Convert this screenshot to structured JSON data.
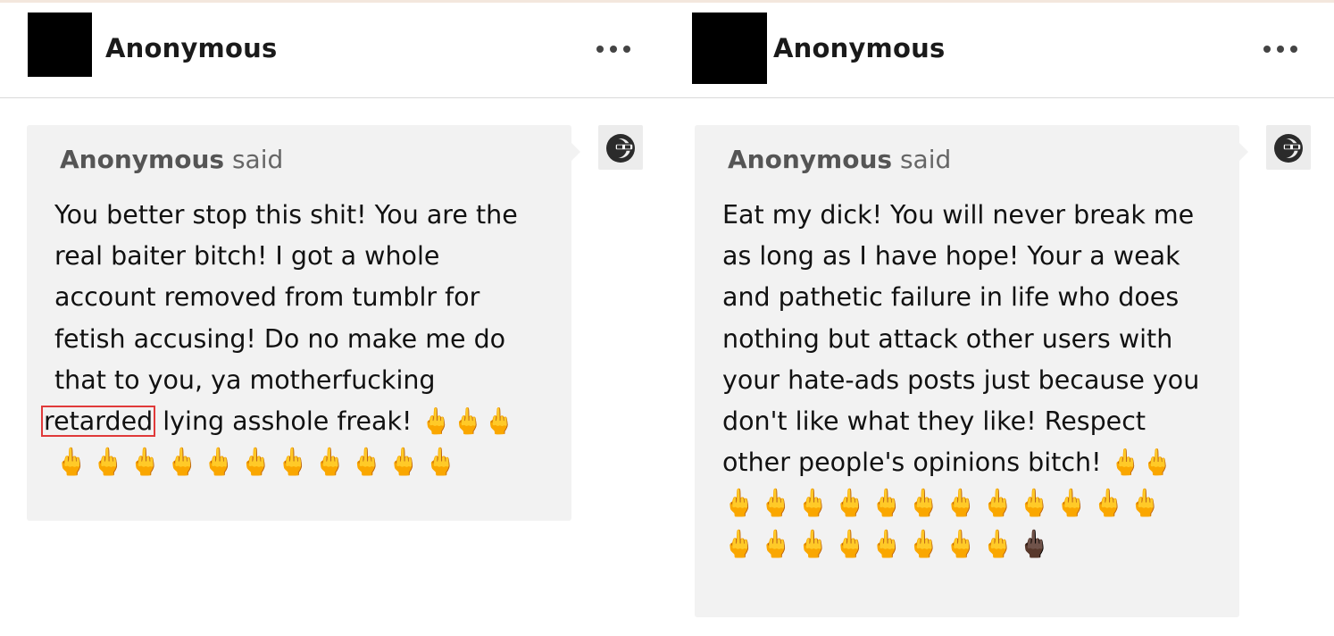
{
  "posts": [
    {
      "username": "Anonymous",
      "more_label": "•••",
      "asker_name": "Anonymous",
      "asker_said": "said",
      "lines": [
        "You better stop this shit! You are the",
        "real baiter bitch! I got a whole",
        "account removed from tumblr for",
        "fetish accusing! Do no make me do",
        "that to you, ya motherfucking"
      ],
      "highlighted_word": "retarded",
      "line_after_highlight": " lying asshole freak! 🖕🖕🖕",
      "emoji_rows": [
        "🖕🖕🖕🖕🖕🖕🖕🖕🖕🖕🖕"
      ],
      "answerer_icon": "sunglasses-face-icon"
    },
    {
      "username": "Anonymous",
      "more_label": "•••",
      "asker_name": "Anonymous",
      "asker_said": "said",
      "lines": [
        "Eat my dick! You will never break me",
        "as long as I have hope! Your a weak",
        "and pathetic failure in life who does",
        "nothing but attack other users with",
        "your hate-ads posts just because you",
        "don't like what they like! Respect",
        "other people's opinions bitch! 🖕🖕"
      ],
      "emoji_rows": [
        "🖕🖕🖕🖕🖕🖕🖕🖕🖕🖕🖕🖕",
        "🖕🖕🖕🖕🖕🖕🖕🖕🖕🏿"
      ],
      "answerer_icon": "sunglasses-face-icon"
    }
  ]
}
